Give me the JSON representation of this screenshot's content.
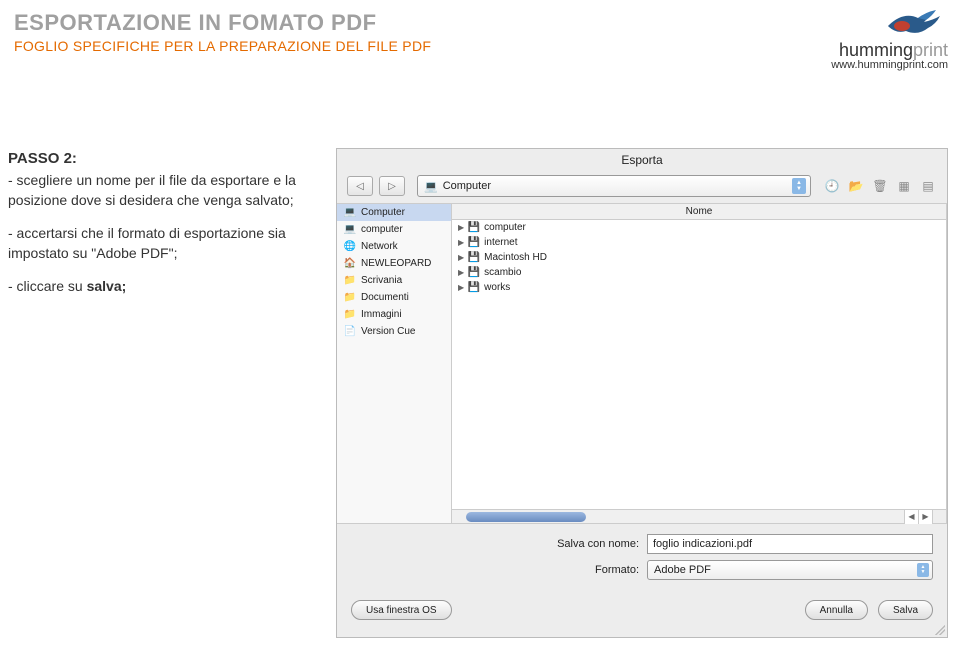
{
  "header": {
    "title_main": "ESPORTAZIONE IN FOMATO PDF",
    "title_sub": "FOGLIO SPECIFICHE PER LA PREPARAZIONE DEL FILE PDF",
    "logo_text_bold": "humming",
    "logo_text_light": "print",
    "url": "www.hummingprint.com"
  },
  "instructions": {
    "step_label": "PASSO 2:",
    "para1": "- scegliere un nome per il file da esportare e la posizione dove si desidera che venga salvato;",
    "para2": "- accertarsi che il formato di esportazione sia impostato su \"Adobe PDF\";",
    "para3_pre": "- cliccare su ",
    "para3_bold": "salva;"
  },
  "dialog": {
    "title": "Esporta",
    "location_popup": "Computer",
    "sidebar": {
      "items": [
        {
          "icon": "💻",
          "label": "Computer",
          "selected": true
        },
        {
          "icon": "💻",
          "label": "computer"
        },
        {
          "icon": "🌐",
          "label": "Network"
        },
        {
          "icon": "🏠",
          "label": "NEWLEOPARD"
        },
        {
          "icon": "📁",
          "label": "Scrivania"
        },
        {
          "icon": "📁",
          "label": "Documenti"
        },
        {
          "icon": "📁",
          "label": "Immagini"
        },
        {
          "icon": "📄",
          "label": "Version Cue"
        }
      ]
    },
    "column_header": "Nome",
    "files": [
      {
        "icon": "💾",
        "label": "computer"
      },
      {
        "icon": "💾",
        "label": "internet"
      },
      {
        "icon": "💾",
        "label": "Macintosh HD"
      },
      {
        "icon": "💾",
        "label": "scambio"
      },
      {
        "icon": "💾",
        "label": "works"
      }
    ],
    "form": {
      "name_label": "Salva con nome:",
      "name_value": "foglio indicazioni.pdf",
      "format_label": "Formato:",
      "format_value": "Adobe PDF"
    },
    "buttons": {
      "use_os": "Usa finestra OS",
      "cancel": "Annulla",
      "save": "Salva"
    }
  }
}
